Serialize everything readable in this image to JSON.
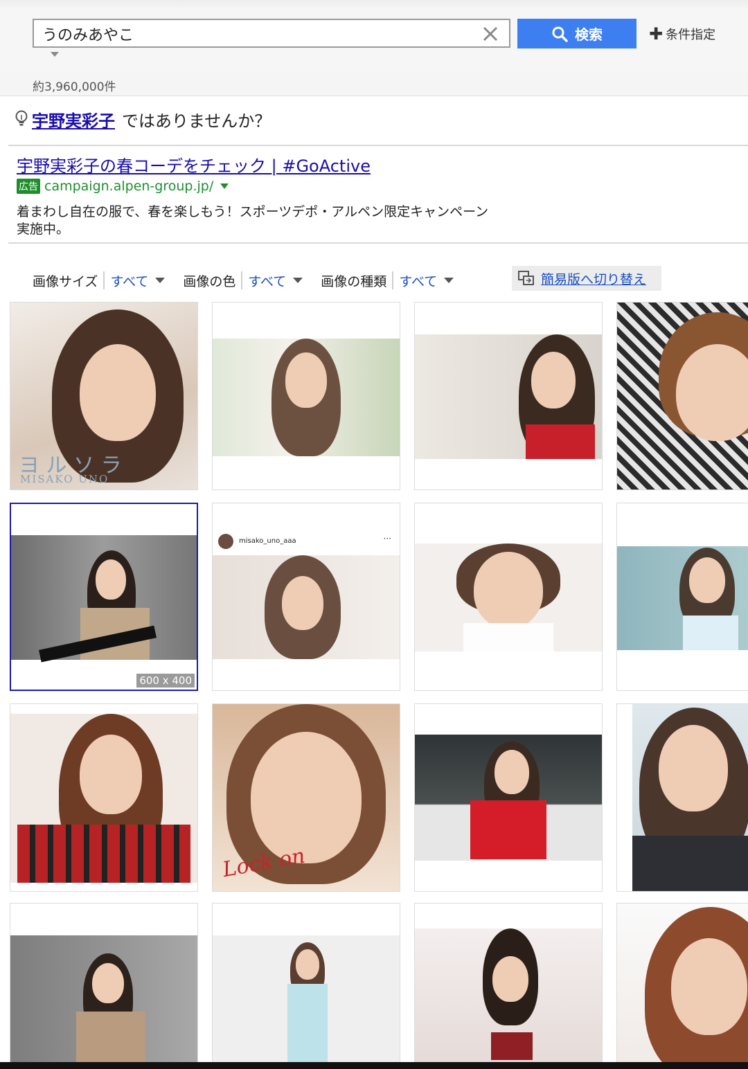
{
  "search": {
    "query": "うのみあやこ",
    "button_label": "検索",
    "conditions_label": "条件指定"
  },
  "result_count": "約3,960,000件",
  "suggestion": {
    "link": "宇野実彩子",
    "suffix": "ではありませんか？"
  },
  "ad": {
    "title": "宇野実彩子の春コーデをチェック | #GoActive",
    "badge": "広告",
    "url": "campaign.alpen-group.jp/",
    "description": "着まわし自在の服で、春を楽しもう！スポーツデポ・アルペン限定キャンペーン実施中。"
  },
  "filters": [
    {
      "label": "画像サイズ",
      "value": "すべて"
    },
    {
      "label": "画像の色",
      "value": "すべて"
    },
    {
      "label": "画像の種類",
      "value": "すべて"
    }
  ],
  "simple_toggle": "簡易版へ切り替え",
  "tiles": {
    "t1_text_jp": "ヨ ル ソ ラ",
    "t1_text_en": "MISAKO UNO",
    "t6_username": "misako_uno_aaa",
    "t6_more": "···",
    "t5_size": "600 x 400",
    "t10_text": "Lock on"
  },
  "colors": {
    "brand_button": "#3d7ff0",
    "link": "#1a0dab",
    "ad_green": "#1e8e2d"
  }
}
